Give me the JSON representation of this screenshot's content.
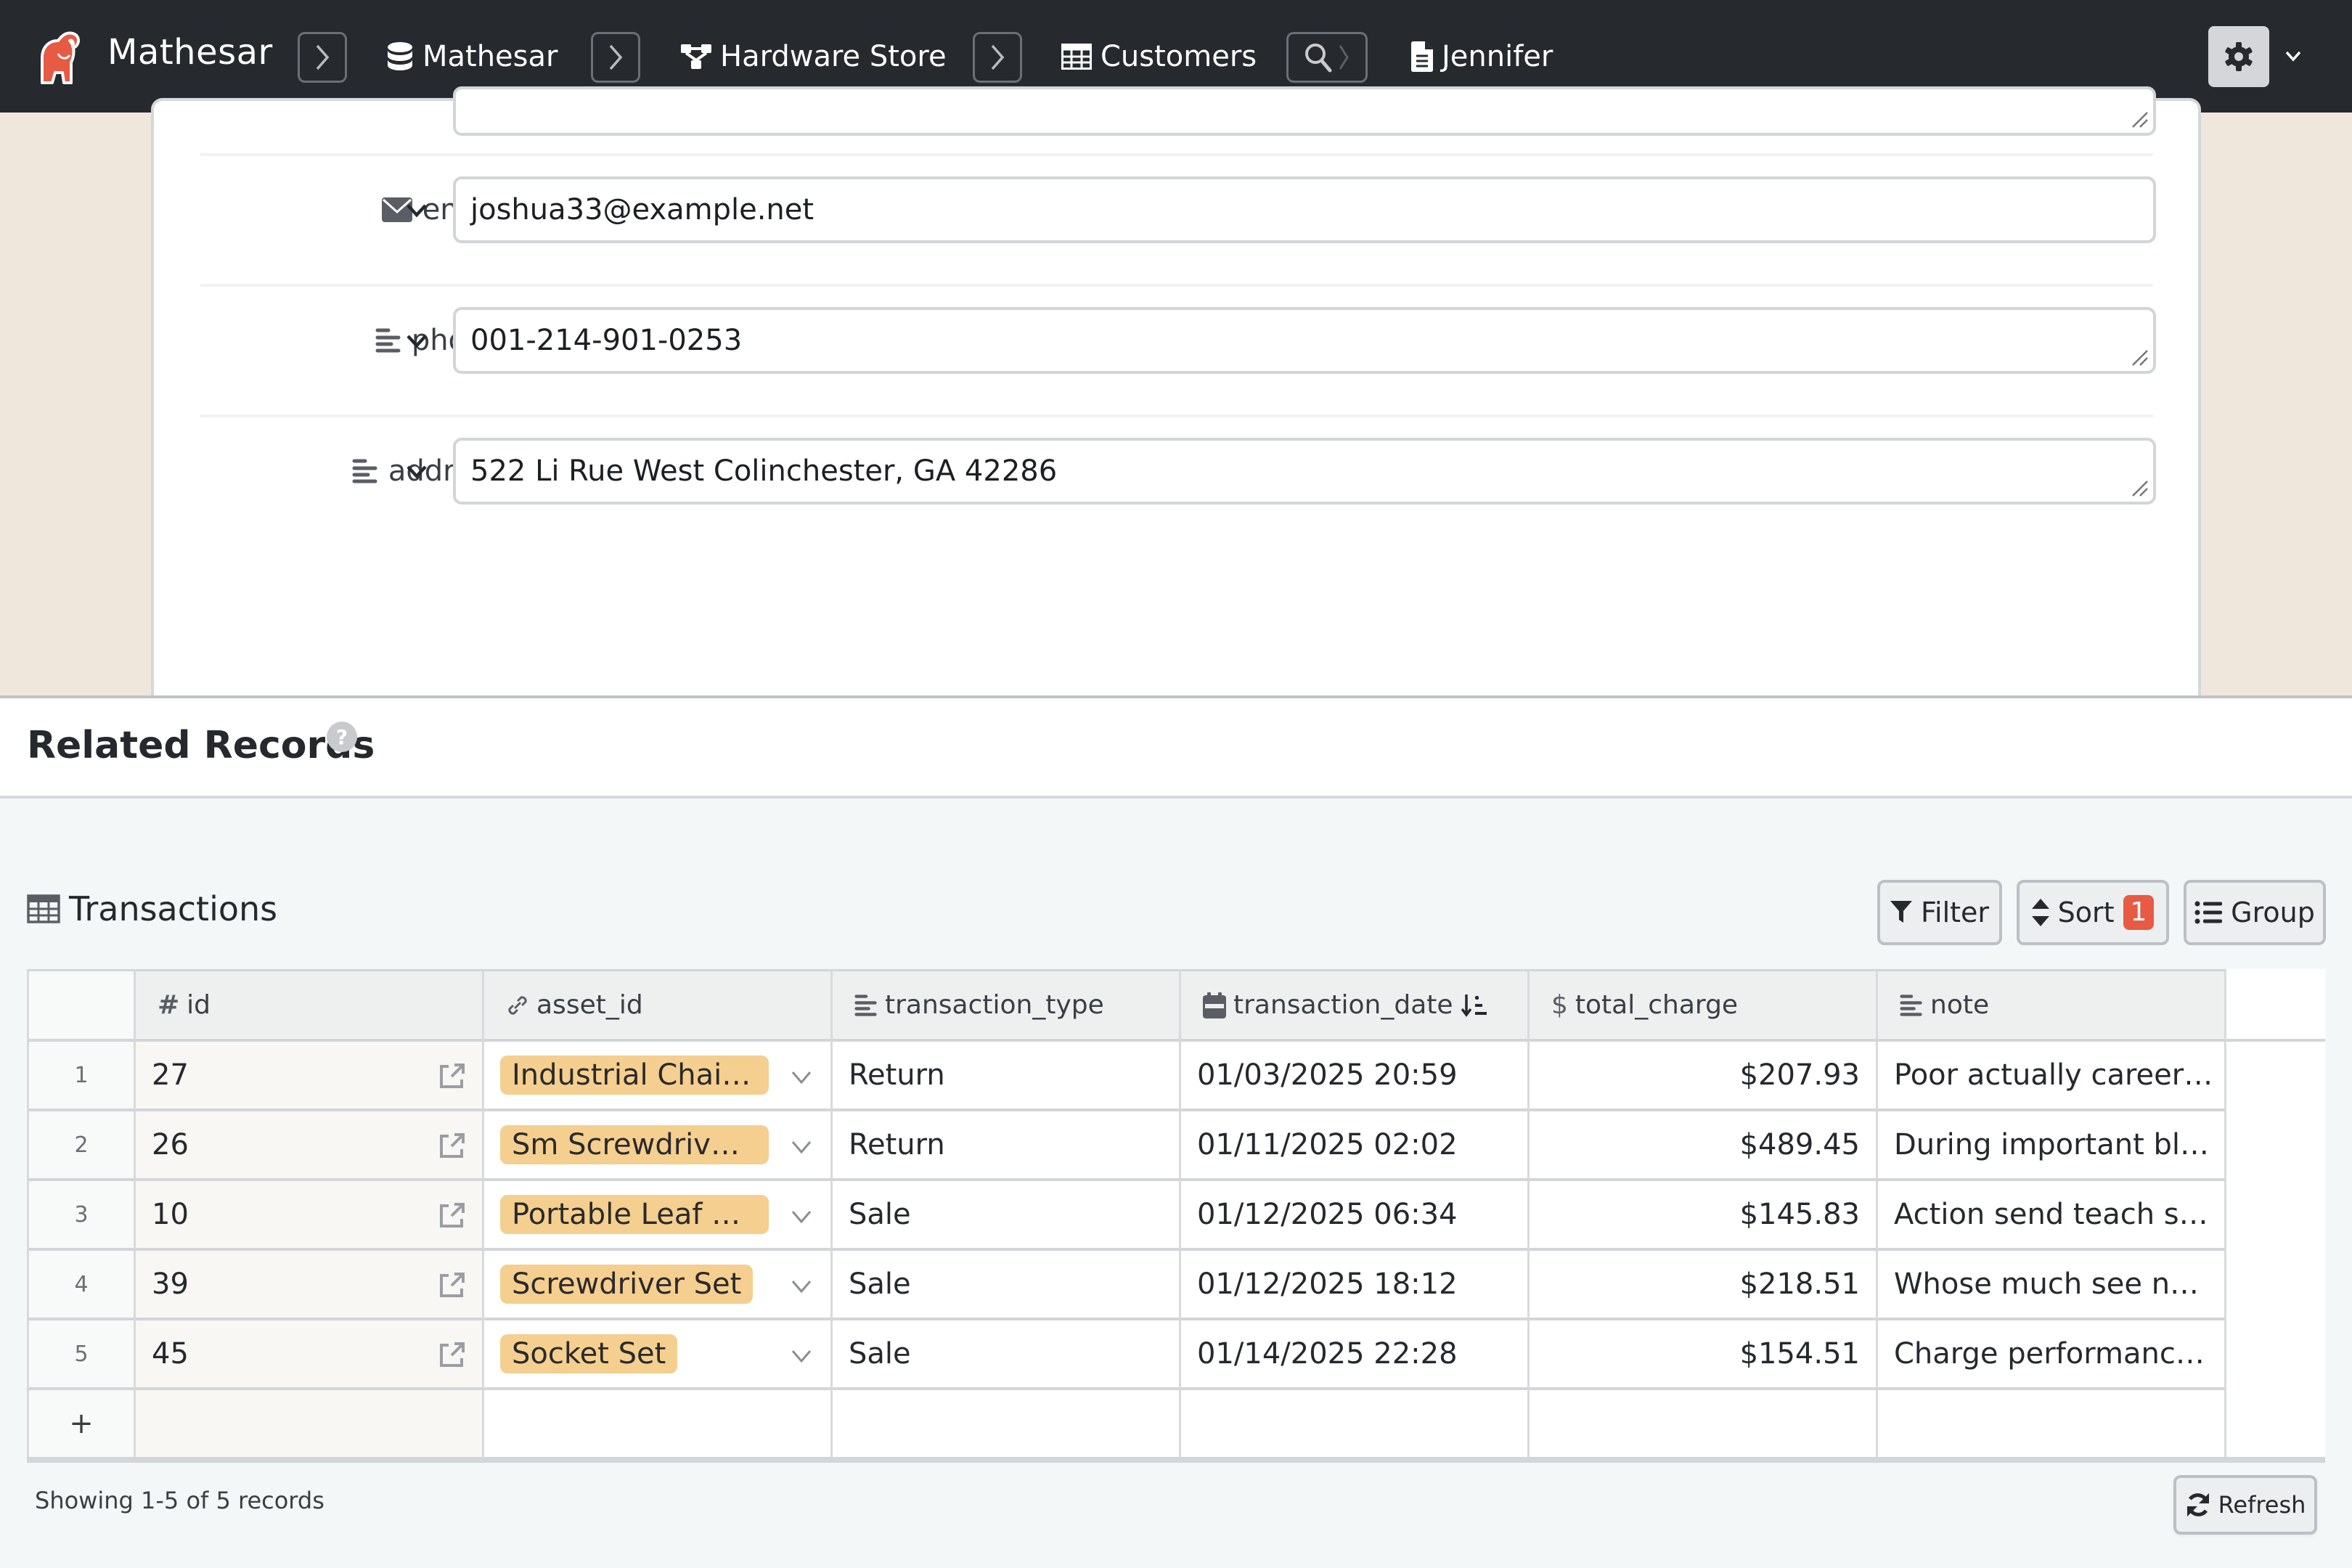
{
  "header": {
    "app_name": "Mathesar",
    "breadcrumbs": [
      {
        "label": "Mathesar",
        "icon": "database-icon"
      },
      {
        "label": "Hardware Store",
        "icon": "schema-icon"
      },
      {
        "label": "Customers",
        "icon": "table-icon"
      },
      {
        "label": "Jennifer",
        "icon": "record-icon"
      }
    ],
    "settings_icon": "gear-icon"
  },
  "record_form": {
    "fields": [
      {
        "name": "email",
        "icon": "email-icon",
        "value": "joshua33@example.net"
      },
      {
        "name": "phone",
        "icon": "text-icon",
        "value": "001-214-901-0253"
      },
      {
        "name": "address",
        "icon": "text-icon",
        "value": "522 Li Rue West Colinchester, GA 42286"
      }
    ]
  },
  "related": {
    "title": "Related Records",
    "help_icon": "?",
    "table_title": "Transactions",
    "toolbar": {
      "filter_label": "Filter",
      "sort_label": "Sort",
      "sort_count": "1",
      "group_label": "Group"
    },
    "columns": [
      {
        "key": "id",
        "label": "id",
        "icon": "#"
      },
      {
        "key": "asset_id",
        "label": "asset_id",
        "icon": "link-icon"
      },
      {
        "key": "transaction_type",
        "label": "transaction_type",
        "icon": "text-icon"
      },
      {
        "key": "transaction_date",
        "label": "transaction_date",
        "icon": "calendar-icon",
        "sorted": "ascending"
      },
      {
        "key": "total_charge",
        "label": "total_charge",
        "icon": "$"
      },
      {
        "key": "note",
        "label": "note",
        "icon": "text-icon"
      }
    ],
    "rows": [
      {
        "row_number": "1",
        "id": "27",
        "asset_id": "Industrial Chain...",
        "transaction_type": "Return",
        "transaction_date": "01/03/2025 20:59",
        "total_charge": "$207.93",
        "note": "Poor actually career ..."
      },
      {
        "row_number": "2",
        "id": "26",
        "asset_id": "Sm Screwdriver...",
        "transaction_type": "Return",
        "transaction_date": "01/11/2025 02:02",
        "total_charge": "$489.45",
        "note": "During important bla..."
      },
      {
        "row_number": "3",
        "id": "10",
        "asset_id": "Portable Leaf Bl...",
        "transaction_type": "Sale",
        "transaction_date": "01/12/2025 06:34",
        "total_charge": "$145.83",
        "note": "Action send teach se..."
      },
      {
        "row_number": "4",
        "id": "39",
        "asset_id": "Screwdriver Set",
        "transaction_type": "Sale",
        "transaction_date": "01/12/2025 18:12",
        "total_charge": "$218.51",
        "note": "Whose much see not..."
      },
      {
        "row_number": "5",
        "id": "45",
        "asset_id": "Socket Set",
        "transaction_type": "Sale",
        "transaction_date": "01/14/2025 22:28",
        "total_charge": "$154.51",
        "note": "Charge performance..."
      }
    ],
    "add_row_label": "+",
    "status": "Showing 1-5 of 5 records",
    "refresh_label": "Refresh"
  },
  "colors": {
    "header_bg": "#26292e",
    "brand": "#e75a43",
    "record_bg": "#efe7db",
    "fk_pill": "#f5cf8f"
  }
}
